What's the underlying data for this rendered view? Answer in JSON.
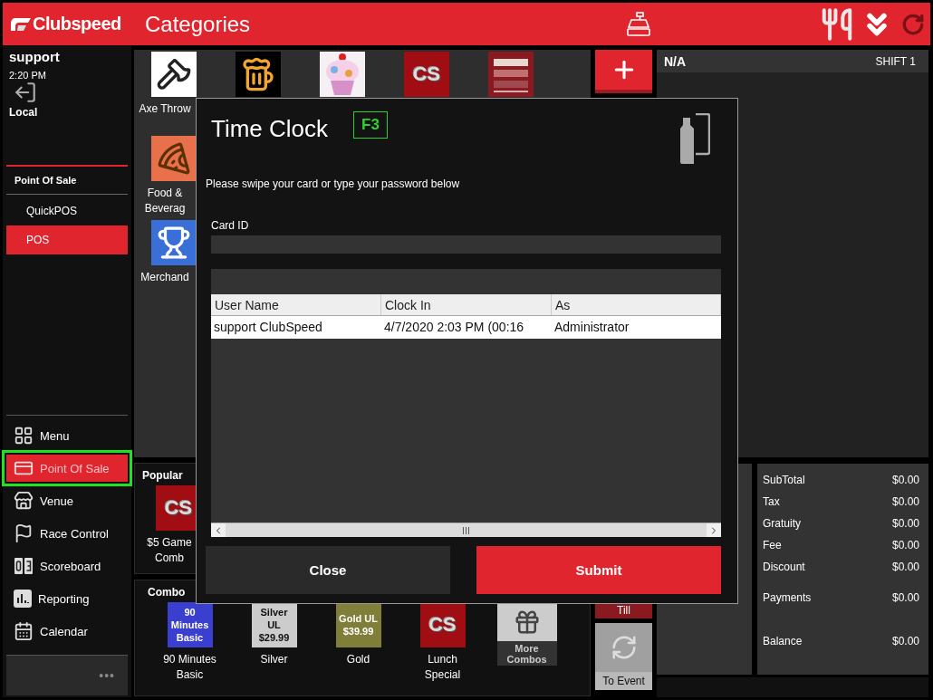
{
  "header": {
    "brand": "Clubspeed",
    "title": "Categories"
  },
  "sidebar": {
    "user": "support",
    "time": "2:20 PM",
    "location": "Local",
    "section": "Point Of Sale",
    "sub_items": [
      {
        "label": "QuickPOS",
        "selected": false
      },
      {
        "label": "POS",
        "selected": true
      }
    ],
    "nav": [
      {
        "label": "Menu",
        "kind": "grid",
        "selected": false,
        "focused": false
      },
      {
        "label": "Point Of Sale",
        "kind": "card",
        "selected": true,
        "focused": true
      },
      {
        "label": "Venue",
        "kind": "store",
        "selected": false,
        "focused": false
      },
      {
        "label": "Race Control",
        "kind": "flag",
        "selected": false,
        "focused": false
      },
      {
        "label": "Scoreboard",
        "kind": "score",
        "selected": false,
        "focused": false
      },
      {
        "label": "Reporting",
        "kind": "chart",
        "selected": false,
        "focused": false
      },
      {
        "label": "Calendar",
        "kind": "calendar",
        "selected": false,
        "focused": false
      }
    ],
    "more": "•••"
  },
  "categories": [
    [
      {
        "kind": "axe",
        "color": "#ffffff",
        "label": "Axe Throw"
      },
      {
        "kind": "beer",
        "color": "#000000"
      },
      {
        "kind": "picture",
        "color": "#f4f0f4"
      },
      {
        "kind": "caption",
        "color": "#a00d12",
        "tile_text": "CS"
      },
      {
        "kind": "picture",
        "color": "#8a1a20"
      }
    ],
    [
      {
        "kind": "pizza",
        "color": "#e8704a",
        "label": "Food & Beverag"
      }
    ],
    [
      {
        "kind": "trophy",
        "color": "#3a6fd8",
        "label": "Merchand"
      }
    ]
  ],
  "popular": {
    "title": "Popular",
    "tiles": [
      {
        "kind": "caption",
        "color": "#a00d12",
        "tile_text": "CS",
        "label": "$5 Game Comb"
      }
    ]
  },
  "combo": {
    "title": "Combo",
    "tiles": [
      {
        "kind": "caption",
        "color": "#3b3fd0",
        "tile_text": "90 Minutes Basic",
        "label": "90 Minutes Basic"
      },
      {
        "kind": "caption",
        "color": "#cccccc",
        "tile_text": "Silver UL $29.99",
        "label": "Silver"
      },
      {
        "kind": "caption",
        "color": "#7f7f3a",
        "tile_text": "Gold UL $39.99",
        "label": "Gold"
      },
      {
        "kind": "caption",
        "color": "#a00d12",
        "tile_text": "CS",
        "label": "Lunch Special"
      },
      {
        "kind": "gift",
        "color": "#cccccc",
        "tile_text": "More Combos"
      }
    ]
  },
  "actions": {
    "till": "Till",
    "to_event": "To Event"
  },
  "order": {
    "name": "N/A",
    "shift": "SHIFT 1"
  },
  "summary": [
    [
      {
        "label": "SubTotal",
        "value": "$0.00"
      },
      {
        "label": "Tax",
        "value": "$0.00"
      },
      {
        "label": "Gratuity",
        "value": "$0.00"
      },
      {
        "label": "Fee",
        "value": "$0.00"
      },
      {
        "label": "Discount",
        "value": "$0.00"
      }
    ],
    [
      {
        "label": "Payments",
        "value": "$0.00"
      }
    ],
    [
      {
        "label": "Balance",
        "value": "$0.00"
      }
    ]
  ],
  "dialog": {
    "title": "Time Clock",
    "hotkey": "F3",
    "instruction": "Please swipe your card or type your password below",
    "card_label": "Card ID",
    "table": {
      "columns": [
        "User Name",
        "Clock In",
        "As"
      ],
      "rows": [
        [
          "support ClubSpeed",
          "4/7/2020 2:03 PM (00:16",
          "Administrator"
        ]
      ]
    },
    "buttons": [
      {
        "label": "Close",
        "kind": "secondary"
      },
      {
        "label": "Submit",
        "kind": "primary"
      }
    ]
  }
}
